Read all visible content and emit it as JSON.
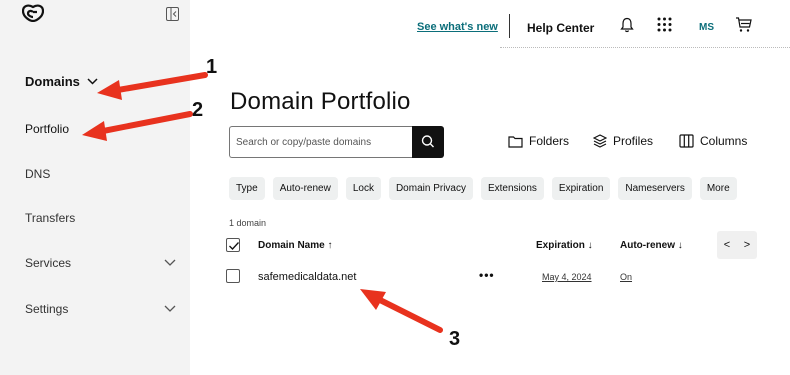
{
  "header": {
    "whats_new": "See what's new",
    "help_center": "Help Center",
    "user_initials": "MS"
  },
  "sidebar": {
    "items": [
      {
        "label": "Domains",
        "expanded": true
      },
      {
        "label": "Portfolio"
      },
      {
        "label": "DNS"
      },
      {
        "label": "Transfers"
      },
      {
        "label": "Services",
        "has_chevron": true
      },
      {
        "label": "Settings",
        "has_chevron": true
      }
    ]
  },
  "main": {
    "title": "Domain Portfolio",
    "search_placeholder": "Search or copy/paste domains",
    "tools": [
      "Folders",
      "Profiles",
      "Columns"
    ],
    "filters": [
      "Type",
      "Auto-renew",
      "Lock",
      "Domain Privacy",
      "Extensions",
      "Expiration",
      "Nameservers",
      "More"
    ],
    "count": "1 domain",
    "columns": {
      "name": "Domain Name ↑",
      "expiration": "Expiration ↓",
      "autorenew": "Auto-renew ↓"
    },
    "rows": [
      {
        "domain": "safemedicaldata.net",
        "expiration": "May 4, 2024",
        "autorenew": "On"
      }
    ],
    "pager": {
      "prev": "<",
      "next": ">"
    }
  },
  "annotations": {
    "labels": [
      "1",
      "2",
      "3"
    ],
    "arrow_color": "#e8321e"
  }
}
